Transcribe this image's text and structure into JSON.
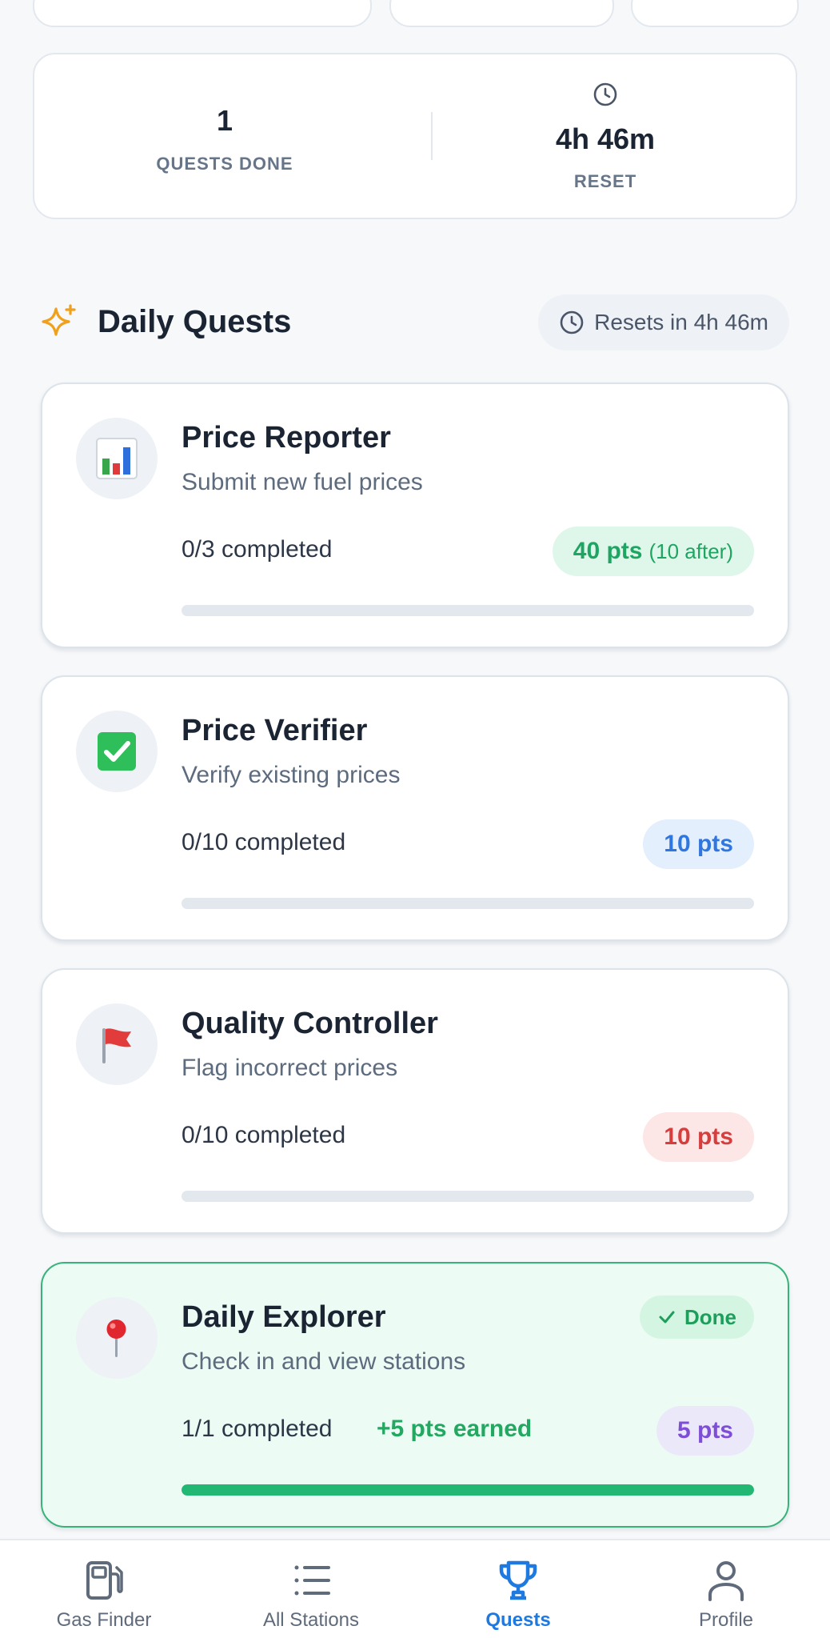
{
  "stats": {
    "quests_done_value": "1",
    "quests_done_label": "QUESTS DONE",
    "reset_value": "4h 46m",
    "reset_label": "RESET"
  },
  "daily_quests": {
    "title": "Daily Quests",
    "reset_text": "Resets in 4h 46m",
    "icons": {
      "section": "sparkle-icon",
      "reset": "clock-icon"
    }
  },
  "quests": [
    {
      "title": "Price Reporter",
      "description": "Submit new fuel prices",
      "progress_text": "0/3 completed",
      "points": "40 pts",
      "points_note": "(10 after)",
      "progress_fraction": 0,
      "icon": "bar-chart-icon",
      "color": "#1fa562"
    },
    {
      "title": "Price Verifier",
      "description": "Verify existing prices",
      "progress_text": "0/10 completed",
      "points": "10 pts",
      "progress_fraction": 0,
      "icon": "check-box-icon",
      "color": "#2f76e0"
    },
    {
      "title": "Quality Controller",
      "description": "Flag incorrect prices",
      "progress_text": "0/10 completed",
      "points": "10 pts",
      "progress_fraction": 0,
      "icon": "red-flag-icon",
      "color": "#d63d3d"
    },
    {
      "title": "Daily Explorer",
      "description": "Check in and view stations",
      "progress_text": "1/1 completed",
      "earned_text": "+5 pts earned",
      "points": "5 pts",
      "status": "Done",
      "progress_fraction": 1,
      "icon": "pushpin-icon",
      "color": "#7e4fd6"
    }
  ],
  "nav": {
    "items": [
      {
        "label": "Gas Finder",
        "icon": "fuel-pump-icon"
      },
      {
        "label": "All Stations",
        "icon": "list-icon"
      },
      {
        "label": "Quests",
        "icon": "trophy-icon",
        "active": true
      },
      {
        "label": "Profile",
        "icon": "person-icon"
      }
    ],
    "active_color": "#1e79e0"
  }
}
